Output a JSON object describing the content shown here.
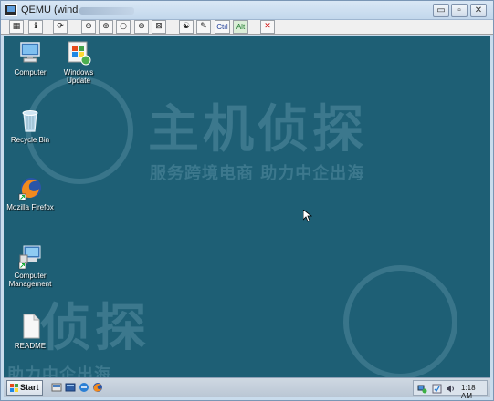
{
  "window": {
    "title": "QEMU (wind",
    "controls": {
      "minimize": "▭",
      "restore": "▫",
      "close": "✕"
    }
  },
  "toolbar": {
    "buttons": [
      {
        "name": "properties-icon",
        "glyph": "▦"
      },
      {
        "name": "info-icon",
        "glyph": "ℹ"
      },
      {
        "name": "refresh-icon",
        "glyph": "⟳"
      },
      {
        "name": "zoom-out-icon",
        "glyph": "⊖"
      },
      {
        "name": "zoom-in-icon",
        "glyph": "⊕"
      },
      {
        "name": "zoom-reset-icon",
        "glyph": "○"
      },
      {
        "name": "zoom-fit-icon",
        "glyph": "⊛"
      },
      {
        "name": "fullscreen-icon",
        "glyph": "⊠"
      },
      {
        "name": "mouse-icon",
        "glyph": "☯"
      },
      {
        "name": "keyboard-icon",
        "glyph": "✎"
      }
    ],
    "ctrl_label": "Ctrl",
    "alt_label": "Alt",
    "close_glyph": "✕"
  },
  "desktop": {
    "background": "#1e5f75",
    "icons": [
      {
        "id": "computer",
        "label": "Computer"
      },
      {
        "id": "windows-update",
        "label": "Windows Update"
      },
      {
        "id": "recycle-bin",
        "label": "Recycle Bin"
      },
      {
        "id": "mozilla-firefox",
        "label": "Mozilla Firefox"
      },
      {
        "id": "computer-management",
        "label": "Computer Management"
      },
      {
        "id": "readme",
        "label": "README"
      }
    ],
    "watermark": {
      "brand": "主机侦探",
      "slogan": "服务跨境电商 助力中企出海",
      "brand_partial": "侦探",
      "slogan_partial": "助力中企出海"
    }
  },
  "taskbar": {
    "start_label": "Start",
    "clock": "1:18 AM"
  }
}
